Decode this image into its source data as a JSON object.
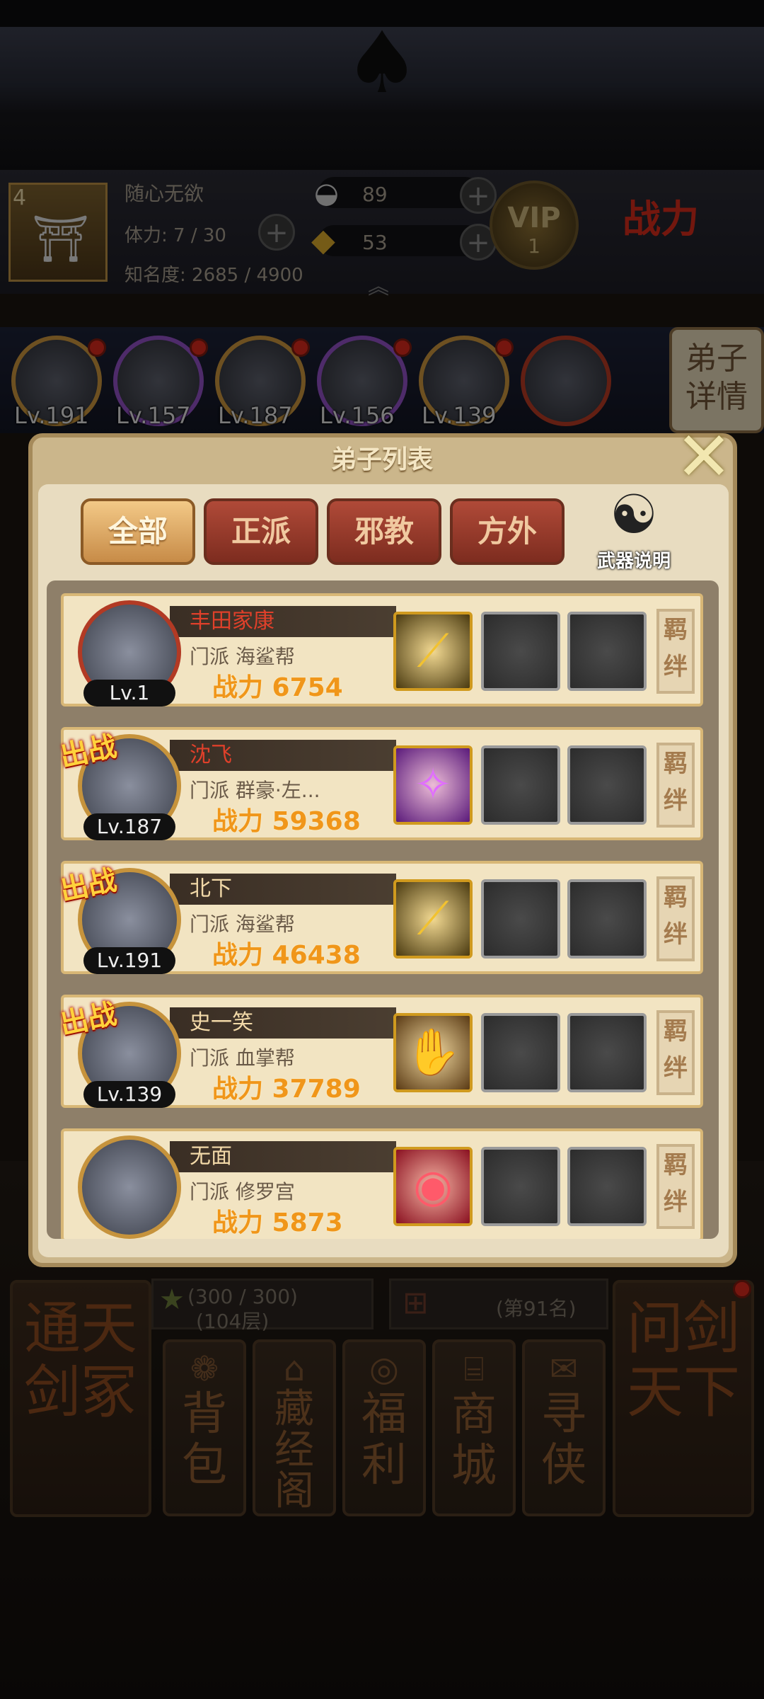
{
  "player": {
    "level": "4",
    "name": "随心无欲",
    "stamina": "体力: 7 / 30",
    "fame": "知名度: 2685 / 4900",
    "silver": "89",
    "gold": "53",
    "vip_label": "VIP",
    "vip_level": "1",
    "power_logo": "战力"
  },
  "hero_strip": {
    "levels": [
      "Lv.191",
      "Lv.157",
      "Lv.187",
      "Lv.156",
      "Lv.139"
    ],
    "ring_colors": [
      "#c6933c",
      "#8f4fc2",
      "#c6933c",
      "#8f4fc2",
      "#c6933c",
      "#b23a24"
    ],
    "detail_button": "弟子详情"
  },
  "modal": {
    "title": "弟子列表",
    "close_icon": "close-x",
    "tabs": [
      "全部",
      "正派",
      "邪教",
      "方外"
    ],
    "active_tab": 0,
    "weapon_info_label": "武器说明",
    "battle_tag": "出战",
    "bond_label": "羁绊",
    "disciples": [
      {
        "name": "丰田家康",
        "name_color": "#e0402a",
        "sect": "门派  海鲨帮",
        "power": "战力 6754",
        "level": "Lv.1",
        "deployed": false,
        "weapon_icon": "golden-slash",
        "weapon_color": "#f2c230",
        "weapon_bg": "#4a3a10",
        "ring_color": "#b23a24"
      },
      {
        "name": "沈飞",
        "name_color": "#e0402a",
        "sect": "门派  群豪·左...",
        "power": "战力 59368",
        "level": "Lv.187",
        "deployed": true,
        "weapon_icon": "purple-strike",
        "weapon_color": "#e06cff",
        "weapon_bg": "#5a1a7a",
        "ring_color": "#c6933c"
      },
      {
        "name": "北下",
        "name_color": "#f2d9a8",
        "sect": "门派  海鲨帮",
        "power": "战力 46438",
        "level": "Lv.191",
        "deployed": true,
        "weapon_icon": "golden-slash",
        "weapon_color": "#f2c230",
        "weapon_bg": "#4a3a10",
        "ring_color": "#c6933c"
      },
      {
        "name": "史一笑",
        "name_color": "#f2d9a8",
        "sect": "门派  血掌帮",
        "power": "战力 37789",
        "level": "Lv.139",
        "deployed": true,
        "weapon_icon": "golden-palm",
        "weapon_color": "#f5c860",
        "weapon_bg": "#5a3a14",
        "ring_color": "#c6933c"
      },
      {
        "name": "无面",
        "name_color": "#f2d9a8",
        "sect": "门派  修罗宫",
        "power": "战力 5873",
        "level": "",
        "deployed": false,
        "weapon_icon": "red-vortex",
        "weapon_color": "#ff5a6a",
        "weapon_bg": "#8a1020",
        "ring_color": "#c6933c"
      }
    ]
  },
  "bottom": {
    "left_pillar": "通天剑冢",
    "right_pillar": "问剑天下",
    "stars_line1": "(300 / 300)",
    "stars_line2": "(104层)",
    "rank_text": "(第91名)",
    "menu": [
      {
        "label": "背包",
        "icon": "bag-icon"
      },
      {
        "label": "藏经阁",
        "icon": "pavilion-icon"
      },
      {
        "label": "福利",
        "icon": "gift-icon"
      },
      {
        "label": "商城",
        "icon": "shop-icon"
      },
      {
        "label": "寻侠",
        "icon": "seek-icon"
      }
    ]
  }
}
